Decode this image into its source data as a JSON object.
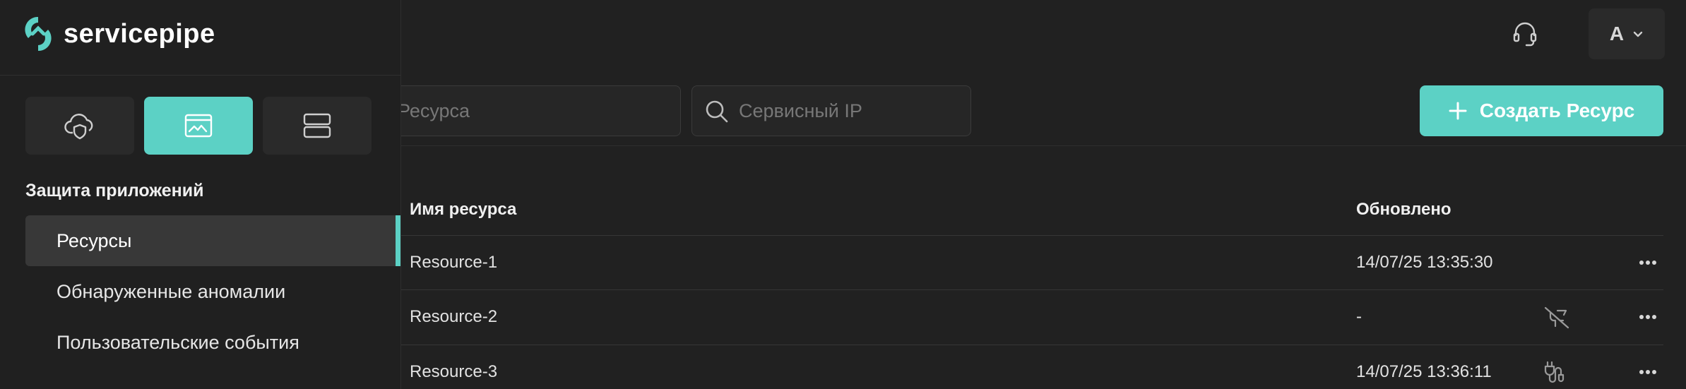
{
  "brand": {
    "name": "servicepipe"
  },
  "header": {
    "account_initial": "A"
  },
  "sidebar": {
    "section_title": "Защита приложений",
    "switcher": [
      {
        "icon": "cloud-shield-icon",
        "active": false
      },
      {
        "icon": "web-window-icon",
        "active": true
      },
      {
        "icon": "server-icon",
        "active": false
      }
    ],
    "items": [
      {
        "label": "Ресурсы",
        "active": true
      },
      {
        "label": "Обнаруженные аномалии",
        "active": false
      },
      {
        "label": "Пользовательские события",
        "active": false
      }
    ]
  },
  "filters": {
    "resource_search_placeholder": "Ресурса",
    "ip_search_placeholder": "Сервисный IP"
  },
  "toolbar": {
    "create_label": "Создать Ресурс"
  },
  "table": {
    "headers": {
      "name": "Имя ресурса",
      "updated": "Обновлено"
    },
    "rows": [
      {
        "name": "Resource-1",
        "updated": "14/07/25 13:35:30",
        "status_icon": ""
      },
      {
        "name": "Resource-2",
        "updated": "-",
        "status_icon": "disconnected-plug-icon"
      },
      {
        "name": "Resource-3",
        "updated": "14/07/25 13:36:11",
        "status_icon": "plug-icon"
      }
    ]
  },
  "colors": {
    "accent": "#5cd1c5",
    "background": "#212121",
    "sidebar": "#202020"
  }
}
